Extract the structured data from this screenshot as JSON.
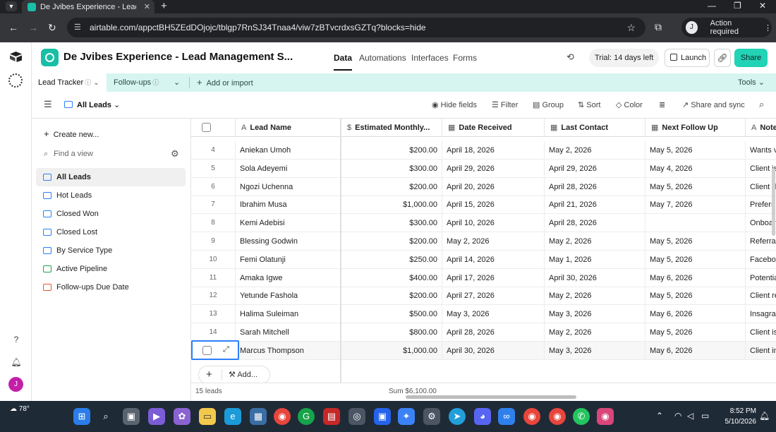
{
  "browser": {
    "tab_title": "De Jvibes Experience - Lead Ma",
    "url": "airtable.com/appctBH5ZEdDOjojc/tblgp7RnSJ34Tnaa4/viw7zBTvcrdxsGZTq?blocks=hide",
    "profile_initial": "J",
    "profile_text": "Action required"
  },
  "header": {
    "base_name": "De Jvibes Experience - Lead Management S...",
    "nav": [
      "Data",
      "Automations",
      "Interfaces",
      "Forms"
    ],
    "trial": "Trial: 14 days left",
    "launch": "Launch",
    "share": "Share",
    "accent_color": "#18bfa6"
  },
  "tables": {
    "active": "Lead Tracker",
    "second": "Follow-ups",
    "add": "Add or import",
    "tools": "Tools"
  },
  "viewbar": {
    "view_name": "All Leads",
    "hide_fields": "Hide fields",
    "filter": "Filter",
    "group": "Group",
    "sort": "Sort",
    "color": "Color",
    "share_sync": "Share and sync"
  },
  "sidebar": {
    "create_new": "Create new...",
    "find_placeholder": "Find a view",
    "views": [
      {
        "label": "All Leads",
        "type": "grid"
      },
      {
        "label": "Hot Leads",
        "type": "grid"
      },
      {
        "label": "Closed Won",
        "type": "grid"
      },
      {
        "label": "Closed Lost",
        "type": "grid"
      },
      {
        "label": "By Service Type",
        "type": "grid"
      },
      {
        "label": "Active Pipeline",
        "type": "kanban"
      },
      {
        "label": "Follow-ups Due Date",
        "type": "calendar"
      }
    ]
  },
  "grid": {
    "columns": [
      "Lead Name",
      "Estimated Monthly...",
      "Date Received",
      "Last Contact",
      "Next Follow Up",
      "Notes"
    ],
    "rows": [
      {
        "n": "4",
        "name": "Aniekan Umoh",
        "value": "$200.00",
        "received": "April 18, 2026",
        "last": "May 2, 2026",
        "next": "May 5, 2026",
        "notes": "Wants v"
      },
      {
        "n": "5",
        "name": "Sola Adeyemi",
        "value": "$300.00",
        "received": "April 29, 2026",
        "last": "April 29, 2026",
        "next": "May 4, 2026",
        "notes": "Client is"
      },
      {
        "n": "6",
        "name": "Ngozi Uchenna",
        "value": "$200.00",
        "received": "April 20, 2026",
        "last": "April 28, 2026",
        "next": "May 5, 2026",
        "notes": "Client d"
      },
      {
        "n": "7",
        "name": "Ibrahim Musa",
        "value": "$1,000.00",
        "received": "April 15, 2026",
        "last": "April 21, 2026",
        "next": "May 7, 2026",
        "notes": "Prefers c"
      },
      {
        "n": "8",
        "name": "Kemi Adebisi",
        "value": "$300.00",
        "received": "April 10, 2026",
        "last": "April 28, 2026",
        "next": "",
        "notes": "Onboar"
      },
      {
        "n": "9",
        "name": "Blessing Godwin",
        "value": "$200.00",
        "received": "May 2, 2026",
        "last": "May 2, 2026",
        "next": "May 5, 2026",
        "notes": "Referra"
      },
      {
        "n": "10",
        "name": "Femi Olatunji",
        "value": "$250.00",
        "received": "April 14, 2026",
        "last": "May 1, 2026",
        "next": "May 5, 2026",
        "notes": "Faceboo"
      },
      {
        "n": "11",
        "name": "Amaka Igwe",
        "value": "$400.00",
        "received": "April 17, 2026",
        "last": "April 30, 2026",
        "next": "May 6, 2026",
        "notes": "Potentia"
      },
      {
        "n": "12",
        "name": "Yetunde Fashola",
        "value": "$200.00",
        "received": "April 27, 2026",
        "last": "May 2, 2026",
        "next": "May 5, 2026",
        "notes": "Client re"
      },
      {
        "n": "13",
        "name": "Halima Suleiman",
        "value": "$500.00",
        "received": "May 3, 2026",
        "last": "May 3, 2026",
        "next": "May 6, 2026",
        "notes": "Insagran"
      },
      {
        "n": "14",
        "name": "Sarah Mitchell",
        "value": "$800.00",
        "received": "April 28, 2026",
        "last": "May 2, 2026",
        "next": "May 5, 2026",
        "notes": "Client is"
      },
      {
        "n": "",
        "name": "Marcus Thompson",
        "value": "$1,000.00",
        "received": "April 30, 2026",
        "last": "May 3, 2026",
        "next": "May 6, 2026",
        "notes": "Client in"
      }
    ],
    "add_label": "Add...",
    "record_count": "15 leads",
    "sum": "Sum $6,100.00"
  },
  "taskbar": {
    "weather": "78°",
    "time": "8:52 PM",
    "date": "5/10/2026"
  }
}
